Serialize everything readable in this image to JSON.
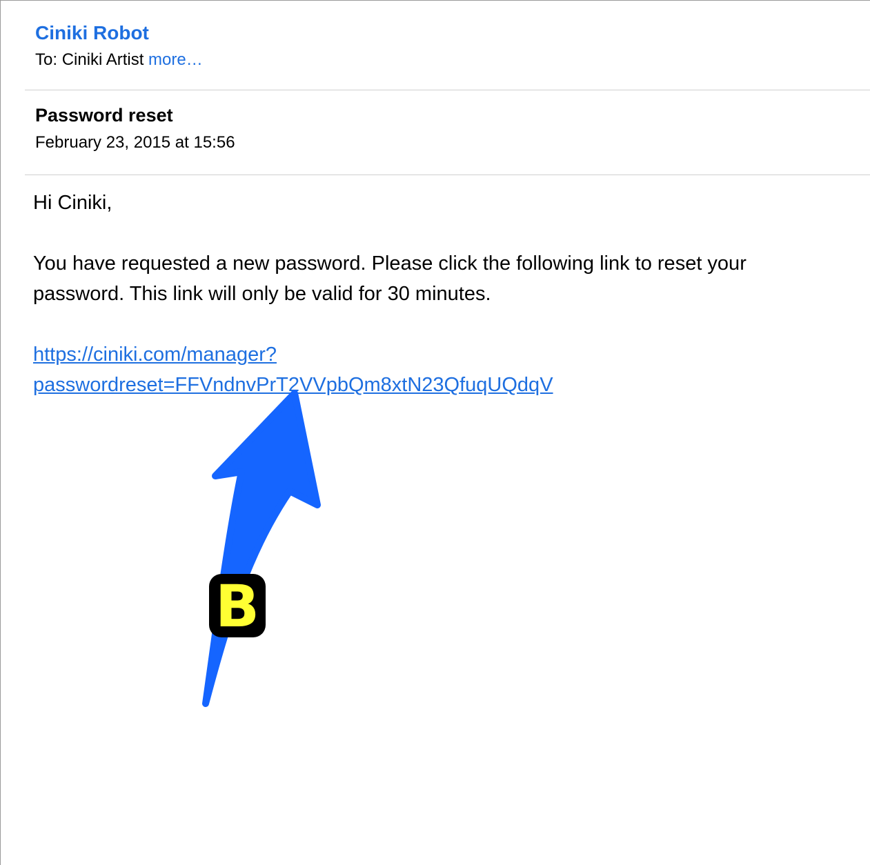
{
  "email": {
    "sender": "Ciniki Robot",
    "to_prefix": "To:",
    "to_name": "Ciniki Artist",
    "more_link": "more…",
    "subject": "Password reset",
    "date": "February 23, 2015 at 15:56",
    "greeting": "Hi Ciniki,",
    "message": "You have requested a new password.  Please click the following link to reset your password.  This link will only be valid for 30 minutes.",
    "link_line_1": "https://ciniki.com/manager?",
    "link_line_2": "passwordreset=FFVndnvPrT2VVpbQm8xtN23QfuqUQdqV"
  },
  "annotation": {
    "label": "B",
    "arrow_color": "#1565ff",
    "badge_color": "#ffff33"
  },
  "colors": {
    "link": "#1e6fe0",
    "divider": "#cfcfcf",
    "frame": "#9a9a9a"
  }
}
